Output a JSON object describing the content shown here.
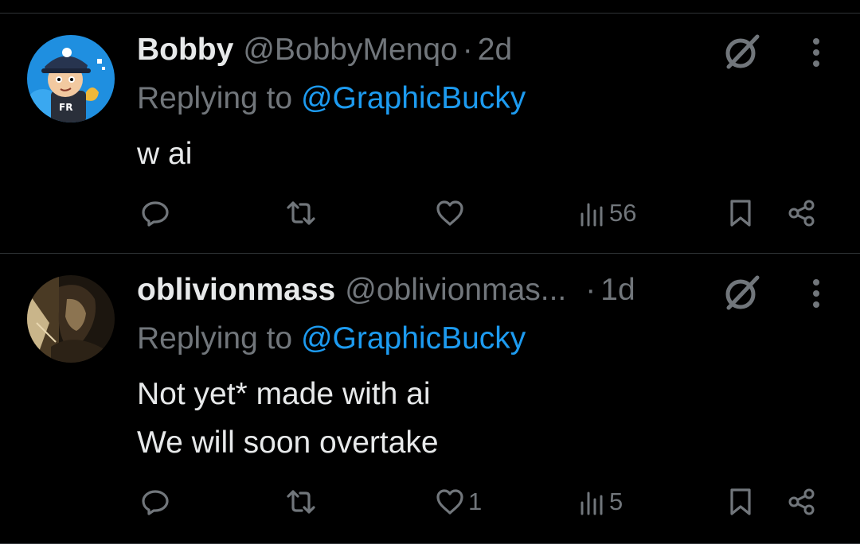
{
  "tweets": [
    {
      "name": "Bobby",
      "handle": "@BobbyMenqo",
      "separator": "·",
      "time": "2d",
      "replying_prefix": "Replying to ",
      "replying_to": "@GraphicBucky",
      "text": "w ai",
      "avatar_icon": "cartoon-avatar-icon",
      "actions": {
        "reply_count": "",
        "retweet_count": "",
        "like_count": "",
        "views_count": "56"
      }
    },
    {
      "name": "oblivionmass",
      "handle": "@oblivionmas...",
      "separator": "·",
      "time": "1d",
      "replying_prefix": "Replying to ",
      "replying_to": "@GraphicBucky",
      "text": "Not yet* made with ai\nWe will soon overtake",
      "avatar_icon": "dark-portrait-avatar-icon",
      "actions": {
        "reply_count": "",
        "retweet_count": "",
        "like_count": "1",
        "views_count": "5"
      }
    }
  ],
  "colors": {
    "background": "#000000",
    "text_primary": "#e7e9ea",
    "text_secondary": "#71767b",
    "mention": "#1d9bf0",
    "divider": "#2f3336"
  }
}
